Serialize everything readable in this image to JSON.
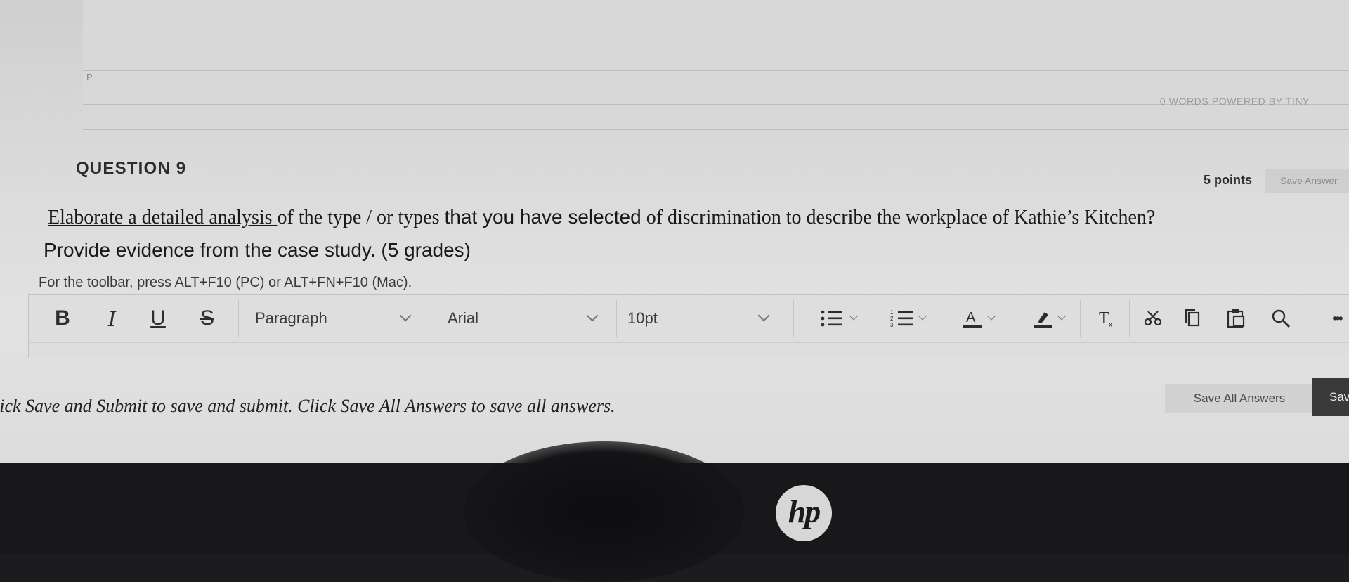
{
  "prev_editor": {
    "p_tag": "P",
    "wordcount": "0 WORDS  POWERED BY TINY"
  },
  "question": {
    "title": "QUESTION 9",
    "points": "5 points",
    "save_answer_label": "Save Answer",
    "text_underlined": "Elaborate a detailed analysis ",
    "text_rest_serif": "of the type / or types ",
    "text_rest_sans": "that you have selected",
    "text_rest_serif2": " of discrimination to describe the workplace of Kathie’s Kitchen?",
    "subtext": "Provide evidence from the case study. (5 grades)"
  },
  "editor": {
    "hint": "For the toolbar, press ALT+F10 (PC) or ALT+FN+F10 (Mac).",
    "toolbar": {
      "bold": "B",
      "italic": "I",
      "underline": "U",
      "strike": "S",
      "paragraph": "Paragraph",
      "font": "Arial",
      "size": "10pt",
      "more": "•••"
    }
  },
  "footer": {
    "instructions": "lick Save and Submit to save and submit. Click Save All Answers to save all answers.",
    "save_all_label": "Save All Answers",
    "save_submit_label": "Sav"
  },
  "bezel": {
    "logo": "hp"
  }
}
